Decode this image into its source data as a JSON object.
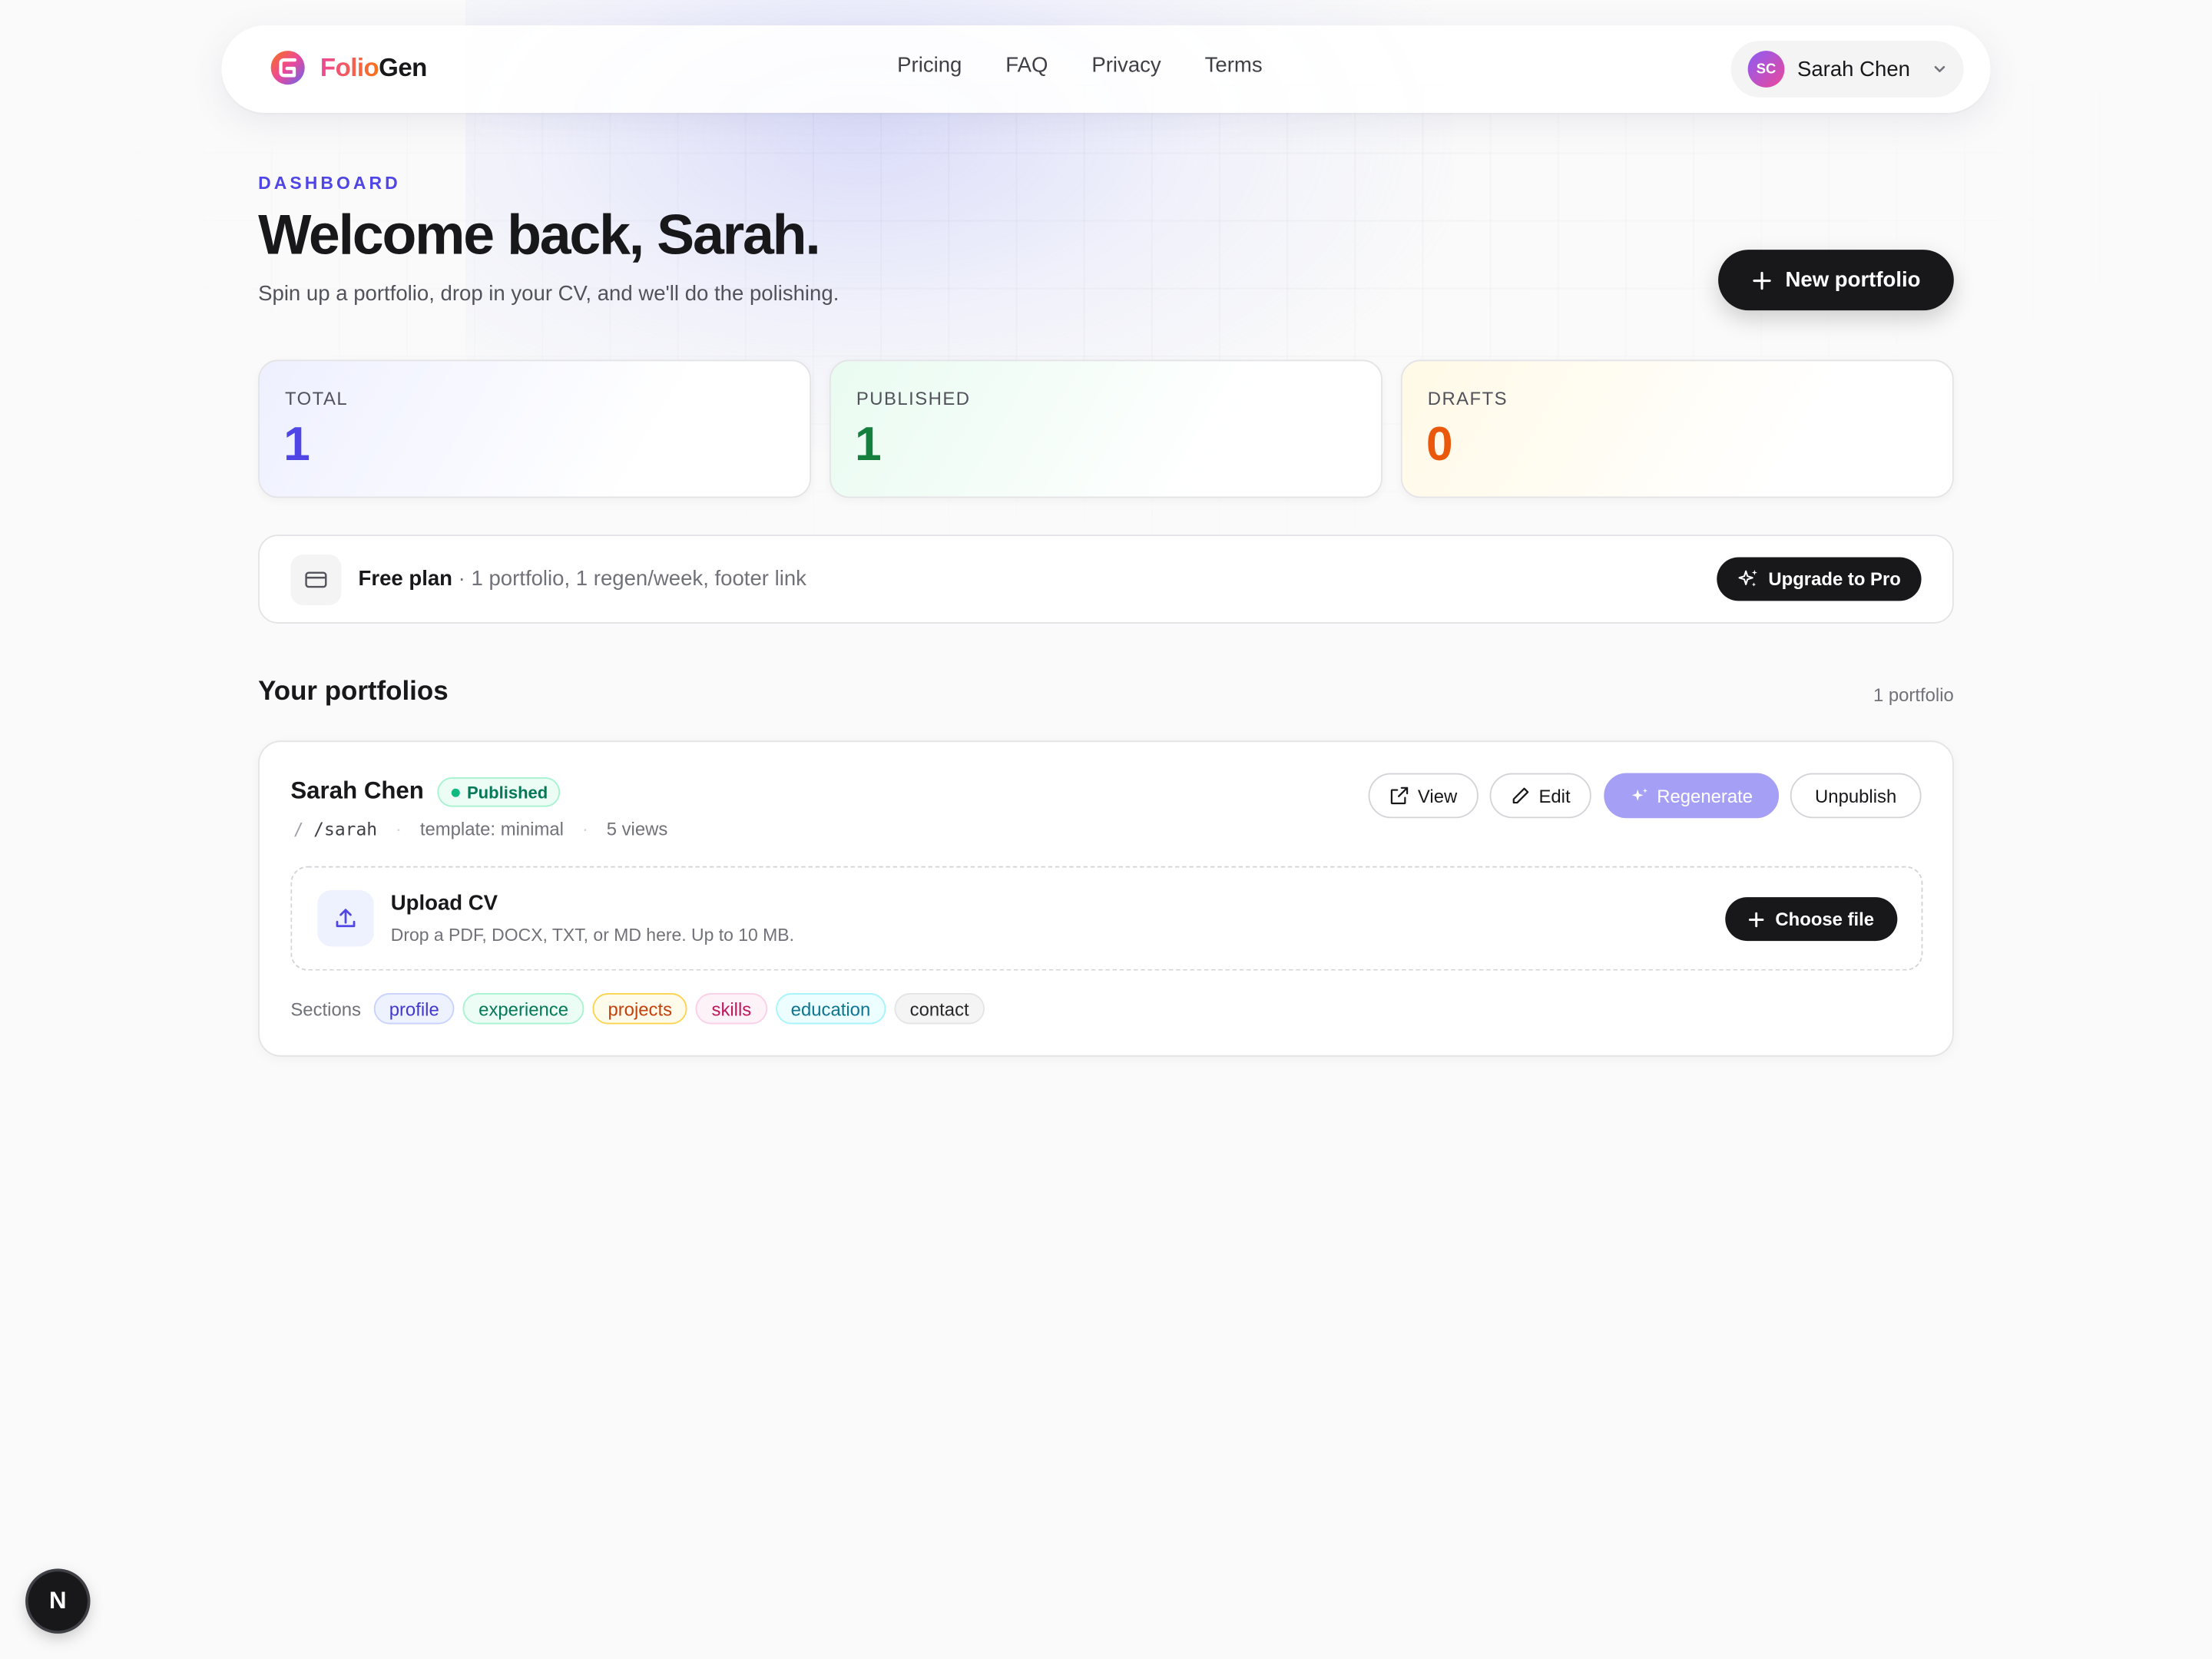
{
  "brand": {
    "name_part1": "Folio",
    "name_part2": "Gen"
  },
  "nav": {
    "links": [
      "Pricing",
      "FAQ",
      "Privacy",
      "Terms"
    ]
  },
  "user": {
    "initials": "SC",
    "name": "Sarah Chen"
  },
  "header": {
    "eyebrow": "DASHBOARD",
    "title": "Welcome back, Sarah.",
    "subtitle": "Spin up a portfolio, drop in your CV, and we'll do the polishing.",
    "new_button": "New portfolio"
  },
  "stats": [
    {
      "label": "TOTAL",
      "value": "1",
      "color": "#4f46e5"
    },
    {
      "label": "PUBLISHED",
      "value": "1",
      "color": "#15803d"
    },
    {
      "label": "DRAFTS",
      "value": "0",
      "color": "#ea580c"
    }
  ],
  "plan": {
    "name": "Free plan",
    "details": " · 1 portfolio, 1 regen/week, footer link",
    "upgrade_button": "Upgrade to Pro"
  },
  "portfolios": {
    "section_title": "Your portfolios",
    "count": "1 portfolio",
    "items": [
      {
        "name": "Sarah Chen",
        "status": "Published",
        "slash": "/",
        "slug": "/sarah",
        "template": "template: minimal",
        "views": "5 views",
        "actions": {
          "view": "View",
          "edit": "Edit",
          "regenerate": "Regenerate",
          "unpublish": "Unpublish"
        },
        "upload": {
          "title": "Upload CV",
          "subtitle": "Drop a PDF, DOCX, TXT, or MD here. Up to 10 MB.",
          "button": "Choose file"
        },
        "sections_label": "Sections",
        "sections": [
          "profile",
          "experience",
          "projects",
          "skills",
          "education",
          "contact"
        ]
      }
    ]
  },
  "dev_indicator": "N"
}
